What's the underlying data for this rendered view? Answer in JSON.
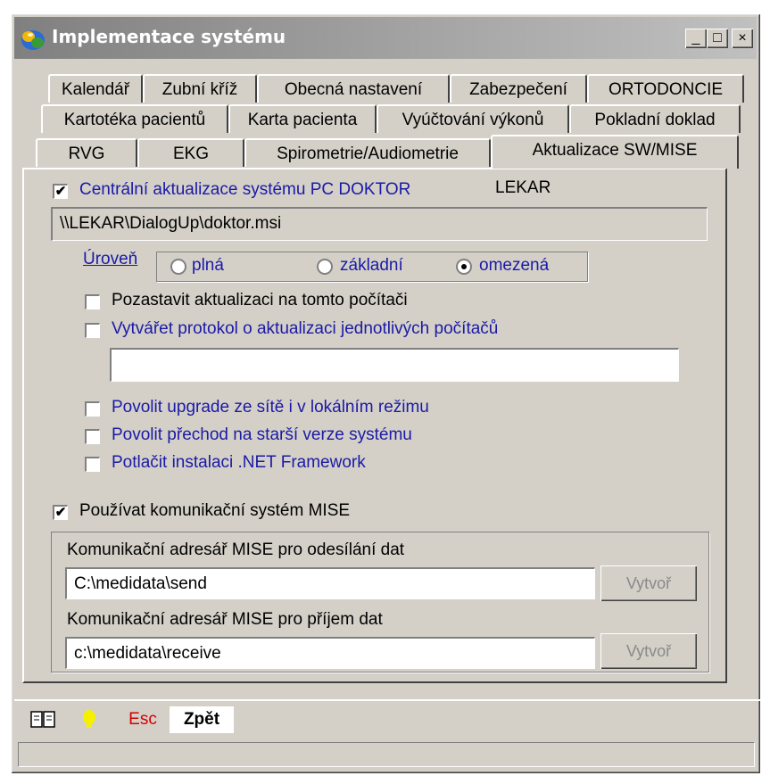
{
  "window": {
    "title": "Implementace systému",
    "minimize": "_",
    "maximize": "□",
    "close": "×"
  },
  "tabs": {
    "row1": [
      "Kalendář",
      "Zubní kříž",
      "Obecná nastavení",
      "Zabezpečení",
      "ORTODONCIE"
    ],
    "row2": [
      "Kartotéka pacientů",
      "Karta pacienta",
      "Vyúčtování výkonů",
      "Pokladní doklad"
    ],
    "row3": [
      "RVG",
      "EKG",
      "Spirometrie/Audiometrie",
      "Aktualizace SW/MISE"
    ]
  },
  "panel": {
    "central_update": {
      "label": "Centrální aktualizace systému PC DOKTOR",
      "checked": true,
      "computer": "LEKAR"
    },
    "msi_path": "\\\\LEKAR\\DialogUp\\doktor.msi",
    "level": {
      "label": "Úroveň",
      "options": [
        "plná",
        "základní",
        "omezená"
      ],
      "selected": "omezená"
    },
    "pause_update": {
      "label": "Pozastavit aktualizaci na tomto počítači",
      "checked": false
    },
    "create_protocol": {
      "label": "Vytvářet protokol o aktualizaci jednotlivých počítačů",
      "checked": false
    },
    "protocol_value": "",
    "allow_upgrade": {
      "label": "Povolit upgrade ze sítě i v lokálním režimu",
      "checked": false
    },
    "allow_downgrade": {
      "label": "Povolit přechod na starší verze systému",
      "checked": false
    },
    "suppress_net": {
      "label": "Potlačit instalaci .NET Framework",
      "checked": false
    },
    "use_mise": {
      "label": "Používat komunikační systém MISE",
      "checked": true
    },
    "send_dir": {
      "label": "Komunikační adresář MISE pro odesílání dat",
      "value": "C:\\medidata\\send",
      "button": "Vytvoř"
    },
    "receive_dir": {
      "label": "Komunikační adresář MISE pro příjem dat",
      "value": "c:\\medidata\\receive",
      "button": "Vytvoř"
    }
  },
  "toolbar": {
    "esc": "Esc",
    "back": "Zpět"
  },
  "colors": {
    "face": "#d4d0c8",
    "label_blue": "#1a1aa6",
    "esc_red": "#d40000"
  }
}
